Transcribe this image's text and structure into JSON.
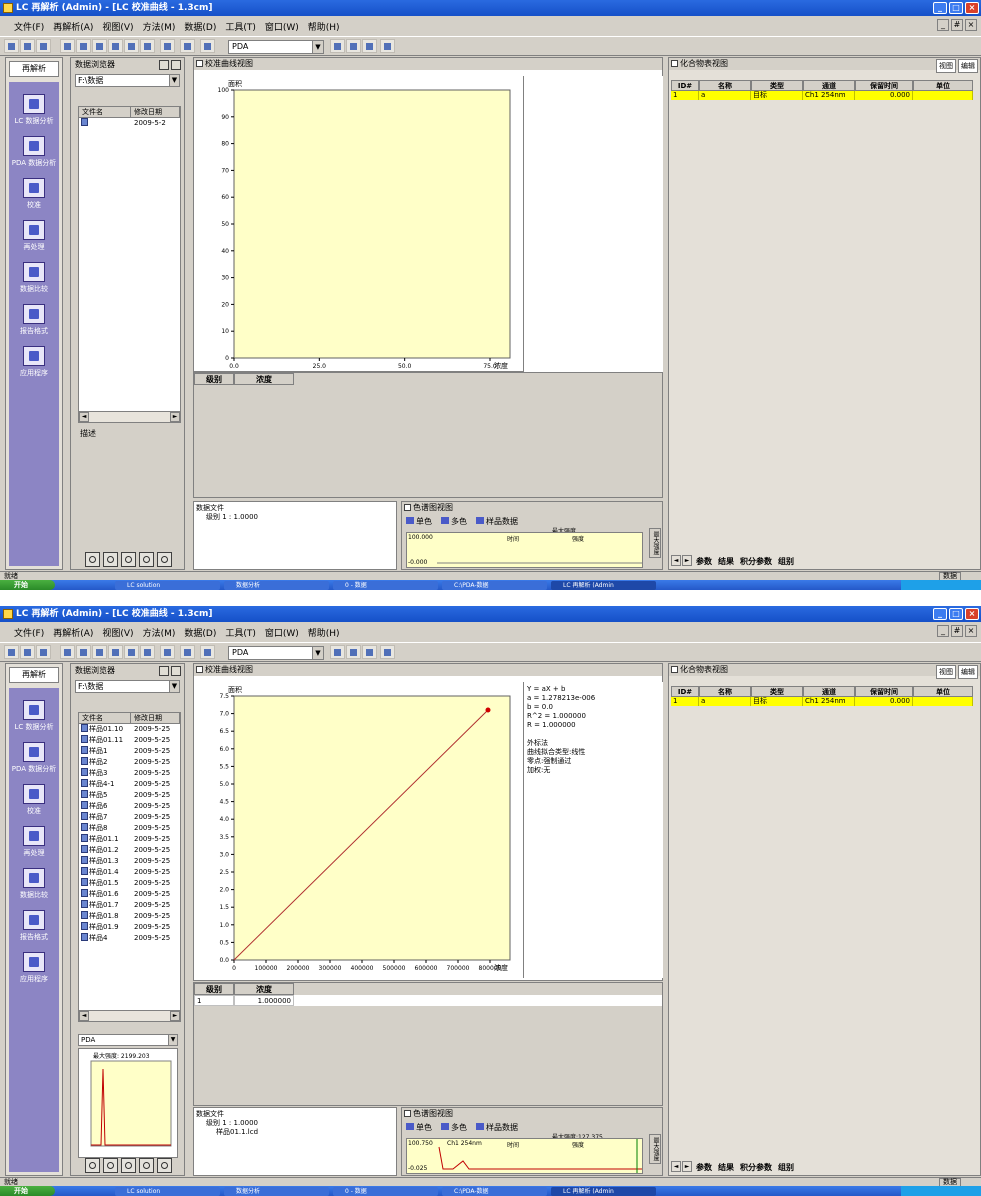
{
  "screens": [
    {
      "window_title": "LC 再解析 (Admin) - [LC 校准曲线 - 1.3cm]",
      "menu": [
        "文件(F)",
        "再解析(A)",
        "视图(V)",
        "方法(M)",
        "数据(D)",
        "工具(T)",
        "窗口(W)",
        "帮助(H)"
      ],
      "toolbar_combo": "PDA",
      "nav_header": "再解析",
      "nav_items": [
        "LC 数据分析",
        "PDA 数据分析",
        "校准",
        "再处理",
        "数据比较",
        "报告格式",
        "应用程序"
      ],
      "explorer_title": "数据浏览器",
      "explorer_path": "F:\\数据",
      "file_columns": [
        "文件名",
        "修改日期"
      ],
      "files": [
        {
          "name": "",
          "date": "2009-5-2"
        }
      ],
      "explorer_footer": "描述",
      "cal_title": "校准曲线视图",
      "cal_ylabel": "面积",
      "cal_yticks": [
        "100",
        "90",
        "80",
        "70",
        "60",
        "50",
        "40",
        "30",
        "20",
        "10",
        "0"
      ],
      "cal_xticks": [
        "0.0",
        "25.0",
        "50.0",
        "75.0"
      ],
      "cal_xunit": "浓度",
      "equation": [],
      "grid_columns": [
        "级别",
        "浓度"
      ],
      "grid_rows": [],
      "compound_file": {
        "root": "数据文件",
        "items": [
          "级别 1 : 1.0000"
        ]
      },
      "chrom": {
        "title": "色谱图视图",
        "tabs": [
          "单色",
          "多色",
          "样品数据"
        ],
        "ytop": "100.000",
        "ybottom": "-0.000",
        "x_label": "时间",
        "y_label": "强度",
        "max_label": "最大强度"
      },
      "chrom_vtab": "最大强度",
      "table_title": "化合物表视图",
      "table_tabs": [
        "视图",
        "编辑"
      ],
      "table_columns": [
        "ID#",
        "名称",
        "类型",
        "通道",
        "保留时间",
        "单位"
      ],
      "table_rows": [
        {
          "id": "1",
          "name": "a",
          "type": "目标",
          "channel": "Ch1 254nm",
          "rt": "0.000",
          "unit": ""
        }
      ],
      "sheet_tabs": [
        "参数",
        "结果",
        "积分参数",
        "组别"
      ],
      "status_left": "就绪",
      "status_right": "数据",
      "start_label": "开始",
      "tasks": [
        "LC solution",
        "数据分析",
        "0 - 数据",
        "C:\\PDA-数据",
        "LC 再解析 (Admin"
      ]
    },
    {
      "window_title": "LC 再解析 (Admin) - [LC 校准曲线 - 1.3cm]",
      "menu": [
        "文件(F)",
        "再解析(A)",
        "视图(V)",
        "方法(M)",
        "数据(D)",
        "工具(T)",
        "窗口(W)",
        "帮助(H)"
      ],
      "toolbar_combo": "PDA",
      "nav_header": "再解析",
      "nav_items": [
        "LC 数据分析",
        "PDA 数据分析",
        "校准",
        "再处理",
        "数据比较",
        "报告格式",
        "应用程序"
      ],
      "explorer_title": "数据浏览器",
      "explorer_path": "F:\\数据",
      "file_columns": [
        "文件名",
        "修改日期"
      ],
      "files": [
        {
          "name": "样品01.10",
          "date": "2009-5-25"
        },
        {
          "name": "样品01.11",
          "date": "2009-5-25"
        },
        {
          "name": "样品1",
          "date": "2009-5-25"
        },
        {
          "name": "样品2",
          "date": "2009-5-25"
        },
        {
          "name": "样品3",
          "date": "2009-5-25"
        },
        {
          "name": "样品4-1",
          "date": "2009-5-25"
        },
        {
          "name": "样品5",
          "date": "2009-5-25"
        },
        {
          "name": "样品6",
          "date": "2009-5-25"
        },
        {
          "name": "样品7",
          "date": "2009-5-25"
        },
        {
          "name": "样品8",
          "date": "2009-5-25"
        },
        {
          "name": "样品01.1",
          "date": "2009-5-25"
        },
        {
          "name": "样品01.2",
          "date": "2009-5-25"
        },
        {
          "name": "样品01.3",
          "date": "2009-5-25"
        },
        {
          "name": "样品01.4",
          "date": "2009-5-25"
        },
        {
          "name": "样品01.5",
          "date": "2009-5-25"
        },
        {
          "name": "样品01.6",
          "date": "2009-5-25"
        },
        {
          "name": "样品01.7",
          "date": "2009-5-25"
        },
        {
          "name": "样品01.8",
          "date": "2009-5-25"
        },
        {
          "name": "样品01.9",
          "date": "2009-5-25"
        },
        {
          "name": "样品4",
          "date": "2009-5-25"
        }
      ],
      "preview_combo": "PDA",
      "preview_label": "最大强度: 2199.203",
      "cal_title": "校准曲线视图",
      "cal_ylabel": "面积",
      "cal_yticks": [
        "7.5",
        "7.0",
        "6.5",
        "6.0",
        "5.5",
        "5.0",
        "4.5",
        "4.0",
        "3.5",
        "3.0",
        "2.5",
        "2.0",
        "1.5",
        "1.0",
        "0.5",
        "0.0"
      ],
      "cal_xticks": [
        "0",
        "100000",
        "200000",
        "300000",
        "400000",
        "500000",
        "600000",
        "700000",
        "800000"
      ],
      "cal_xunit": "浓度",
      "equation": [
        "Y = aX + b",
        "a = 1.278213e-006",
        "b = 0.0",
        "R^2 = 1.000000",
        "R = 1.000000",
        "",
        "外标法",
        "曲线拟合类型:线性",
        "零点:强制通过",
        "加权:无"
      ],
      "grid_columns": [
        "级别",
        "浓度"
      ],
      "grid_rows": [
        {
          "level": "1",
          "conc": "1.000000"
        }
      ],
      "compound_file": {
        "root": "数据文件",
        "items": [
          "级别 1 : 1.0000",
          "样品01.1.lcd"
        ]
      },
      "chrom": {
        "title": "色谱图视图",
        "tabs": [
          "单色",
          "多色",
          "样品数据"
        ],
        "ytop": "100.750",
        "ybottom": "-0.025",
        "x_label": "时间",
        "y_label": "强度",
        "max_label": "最大强度:127.375",
        "trace_label": "Ch1 254nm"
      },
      "chrom_vtab": "最大强度",
      "table_title": "化合物表视图",
      "table_tabs": [
        "视图",
        "编辑"
      ],
      "table_columns": [
        "ID#",
        "名称",
        "类型",
        "通道",
        "保留时间",
        "单位"
      ],
      "table_rows": [
        {
          "id": "1",
          "name": "a",
          "type": "目标",
          "channel": "Ch1 254nm",
          "rt": "0.000",
          "unit": ""
        }
      ],
      "sheet_tabs": [
        "参数",
        "结果",
        "积分参数",
        "组别"
      ],
      "status_left": "就绪",
      "status_right": "数据",
      "start_label": "开始",
      "tasks": [
        "LC solution",
        "数据分析",
        "0 - 数据",
        "C:\\PDA-数据",
        "LC 再解析 (Admin"
      ]
    }
  ]
}
